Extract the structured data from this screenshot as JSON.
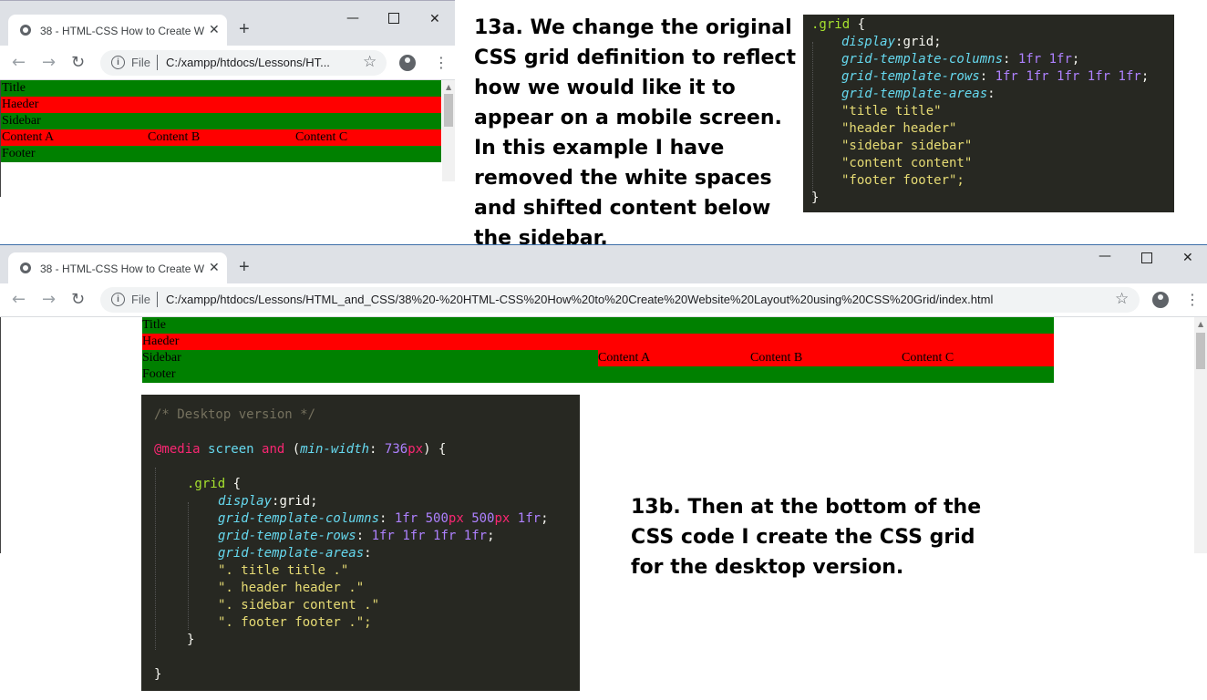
{
  "top_window": {
    "tab_title": "38 - HTML-CSS How to Create W",
    "address": "C:/xampp/htdocs/Lessons/HT...",
    "file_label": "File",
    "rows": [
      {
        "cells": [
          "Title"
        ],
        "color": "green"
      },
      {
        "cells": [
          "Haeder"
        ],
        "color": "red"
      },
      {
        "cells": [
          "Sidebar"
        ],
        "color": "green"
      },
      {
        "cells": [
          "Content A",
          "Content B",
          "Content C"
        ],
        "color": "red"
      },
      {
        "cells": [
          "Footer"
        ],
        "color": "green"
      }
    ]
  },
  "caption_a": "13a. We change the original CSS grid definition to reflect how we would like it to appear on a mobile screen. In this example I have removed the white spaces and shifted content below the sidebar.",
  "code_a": {
    "selector": ".grid",
    "display_prop": "display",
    "display_val": "grid",
    "columns_prop": "grid-template-columns",
    "columns_val": [
      "1fr",
      "1fr"
    ],
    "rows_prop": "grid-template-rows",
    "rows_val": [
      "1fr",
      "1fr",
      "1fr",
      "1fr",
      "1fr"
    ],
    "areas_prop": "grid-template-areas",
    "areas": [
      "\"title title\"",
      "\"header header\"",
      "\"sidebar sidebar\"",
      "\"content content\"",
      "\"footer footer\";"
    ]
  },
  "bottom_window": {
    "tab_title": "38 - HTML-CSS How to Create W",
    "file_label": "File",
    "address": "C:/xampp/htdocs/Lessons/HTML_and_CSS/38%20-%20HTML-CSS%20How%20to%20Create%20Website%20Layout%20using%20CSS%20Grid/index.html",
    "rows": {
      "title": "Title",
      "header": "Haeder",
      "sidebar": "Sidebar",
      "content": [
        "Content A",
        "Content B",
        "Content C"
      ],
      "footer": "Footer"
    }
  },
  "code_b": {
    "comment": "/* Desktop version */",
    "media_kw": "@media",
    "media_type": "screen",
    "and_kw": "and",
    "feature": "min-width",
    "feature_num": "736",
    "feature_unit": "px",
    "selector": ".grid",
    "display_prop": "display",
    "display_val": "grid",
    "columns_prop": "grid-template-columns",
    "rows_prop": "grid-template-rows",
    "rows_val": [
      "1fr",
      "1fr",
      "1fr",
      "1fr"
    ],
    "areas_prop": "grid-template-areas",
    "areas": [
      "\". title title .\"",
      "\". header header .\"",
      "\". sidebar content .\"",
      "\". footer footer .\";"
    ]
  },
  "caption_b": "13b. Then at the bottom of the CSS code I create the CSS grid for the desktop version.",
  "colors": {
    "green": "#008000",
    "red": "#ff0000",
    "code_bg": "#272822"
  }
}
